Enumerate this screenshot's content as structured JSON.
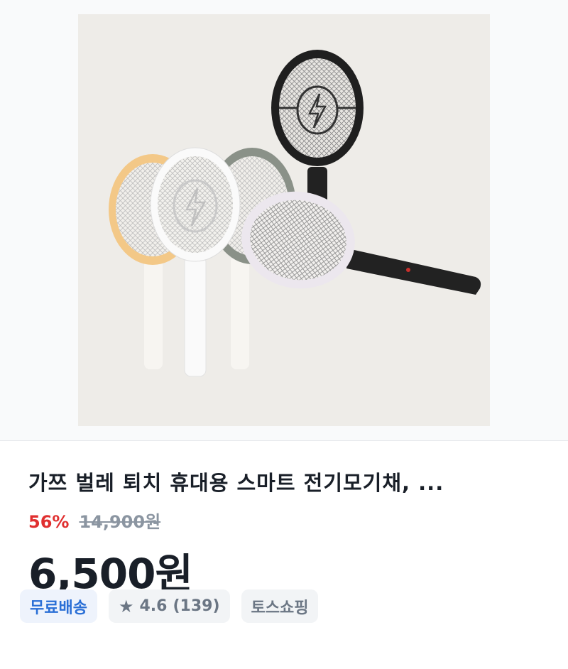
{
  "product": {
    "image_alt": "전기모기채 5종 색상",
    "title": "가쯔 벌레 퇴치 휴대용 스마트 전기모기채, ...",
    "discount_rate": "56%",
    "original_price": "14,900원",
    "final_price": "6,500원"
  },
  "chips": {
    "shipping": "무료배송",
    "rating_star": "★",
    "rating": "4.6",
    "review_count": "(139)",
    "store": "토스쇼핑"
  },
  "colors": {
    "discount": "#e02f2f",
    "shipping_chip_text": "#2a6fd6",
    "shipping_chip_bg": "#eef3fc",
    "neutral_chip_bg": "#f2f4f6"
  }
}
